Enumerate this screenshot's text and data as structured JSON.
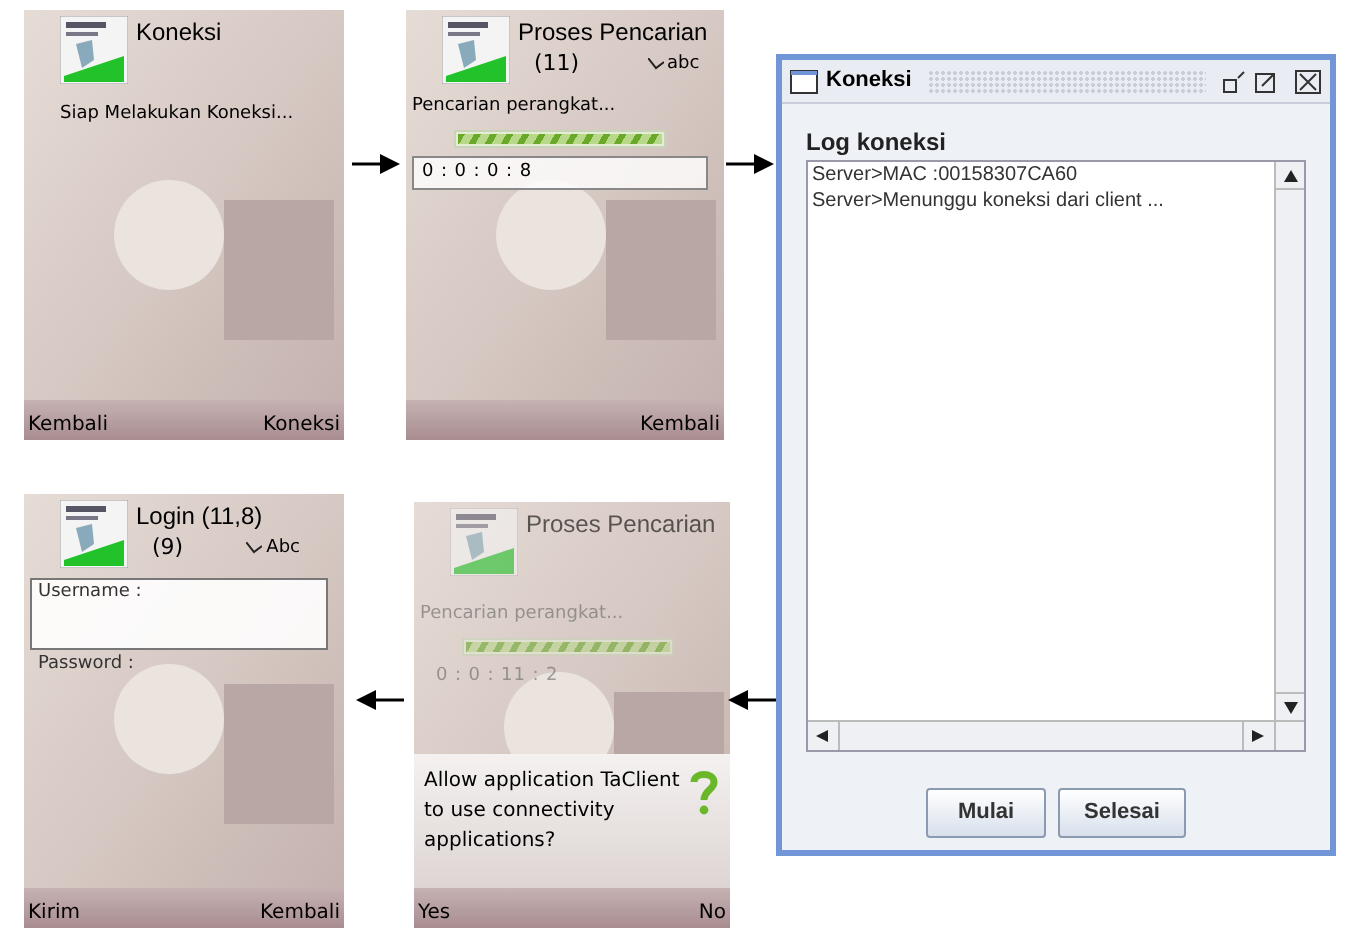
{
  "phone_connect": {
    "title": "Koneksi",
    "status": "Siap Melakukan Koneksi...",
    "softkey_left": "Kembali",
    "softkey_right": "Koneksi"
  },
  "phone_search": {
    "title": "Proses Pencarian",
    "count": "(11)",
    "input_mode": "abc",
    "status": "Pencarian perangkat...",
    "progress": {
      "level": 1
    },
    "timer": "0 : 0 : 0 : 8",
    "softkey_right": "Kembali"
  },
  "java_window": {
    "title": "Koneksi",
    "log_label": "Log koneksi",
    "log_lines": [
      "Server>MAC :00158307CA60",
      "Server>Menunggu koneksi dari client ..."
    ],
    "buttons": [
      "Mulai",
      "Selesai"
    ]
  },
  "phone_login": {
    "title": "Login (11,8)",
    "count": "(9)",
    "input_mode": "Abc",
    "fields": [
      {
        "label": "Username :",
        "selected": true
      },
      {
        "label": "Password :",
        "selected": false
      }
    ],
    "softkey_left": "Kirim",
    "softkey_right": "Kembali"
  },
  "phone_permission": {
    "title": "Proses Pencarian",
    "status": "Pencarian perangkat...",
    "progress": {
      "level": 1
    },
    "timer": "0 : 0 : 11 : 2",
    "dialog": {
      "text": "Allow application TaClient to use connectivity applications?"
    },
    "softkey_left": "Yes",
    "softkey_right": "No"
  }
}
